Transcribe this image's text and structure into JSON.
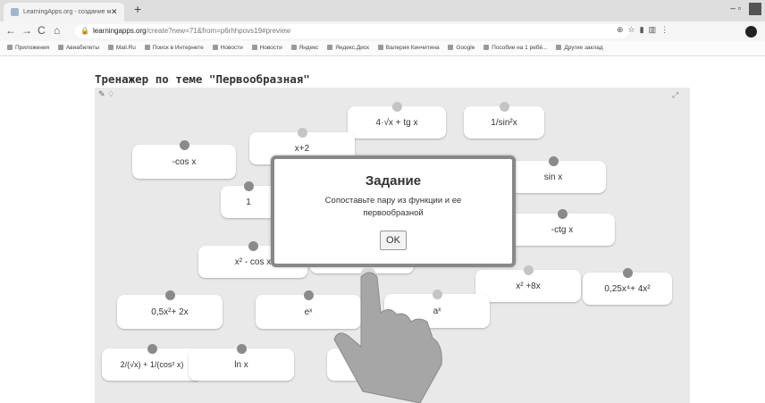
{
  "browser": {
    "tab_title": "LearningApps.org - создание м",
    "tab_close": "✕",
    "new_tab": "+",
    "url_domain": "learningapps.org",
    "url_path": "/create?new=71&from=p6rhhpovs19#preview",
    "bookmarks": [
      "Приложения",
      "Авиабилеты",
      "Mail.Ru",
      "Поиск в Интернете",
      "Новости",
      "Новости",
      "Яндекс",
      "Яндекс.Диск",
      "Валерия Кинчитина",
      "Google",
      "Пособие на 1 ребё...",
      "Другие заклад"
    ]
  },
  "page": {
    "title": "Тренажер по теме \"Первообразная\""
  },
  "cards": [
    {
      "label": "4·√x + tg x"
    },
    {
      "label": "1/sin²x"
    },
    {
      "label": "-cos x"
    },
    {
      "label": "x+2"
    },
    {
      "label": "sin x"
    },
    {
      "label": "1"
    },
    {
      "label": "-ctg x"
    },
    {
      "label": "x² - cos x"
    },
    {
      "label": "x² +8x"
    },
    {
      "label": "0,25x⁴+ 4x²"
    },
    {
      "label": "0,5x²+ 2x"
    },
    {
      "label": "eˣ"
    },
    {
      "label": "aˣ"
    },
    {
      "label": "2/(√x) + 1/(cos² x)"
    },
    {
      "label": "ln x"
    }
  ],
  "dialog": {
    "title": "Задание",
    "text": "Сопоставьте пару из функции и ее первообразной",
    "ok": "OK"
  },
  "colors": {
    "app_bg": "#e9e9e9",
    "card_bg": "#ffffff",
    "pin": "#8a8a8a"
  }
}
